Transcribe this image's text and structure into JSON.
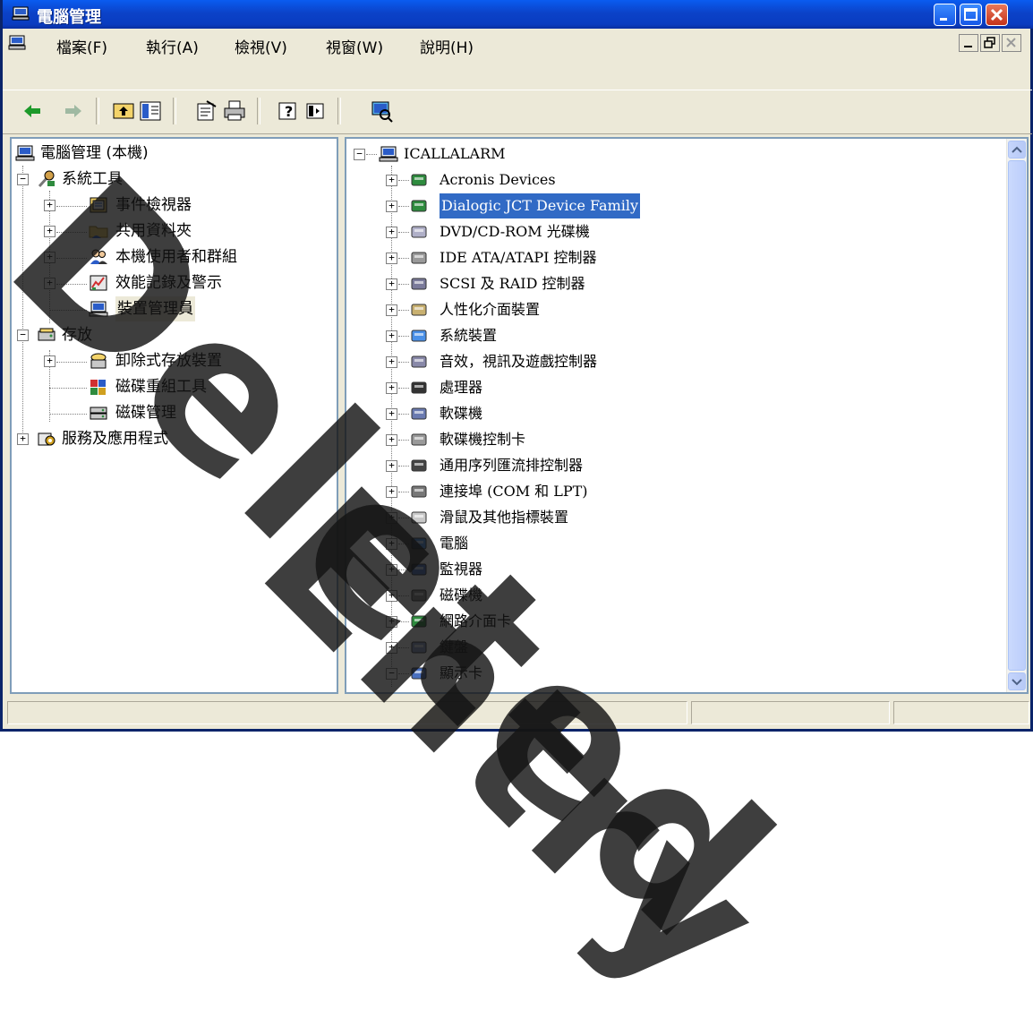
{
  "window": {
    "title": "電腦管理"
  },
  "menu": [
    "檔案(F)",
    "執行(A)",
    "檢視(V)",
    "視窗(W)",
    "說明(H)"
  ],
  "tree": {
    "root": "電腦管理 (本機)",
    "system_tools": "系統工具",
    "event_viewer": "事件檢視器",
    "shared_folders": "共用資料夾",
    "local_users": "本機使用者和群組",
    "perf_logs": "效能記錄及警示",
    "device_manager": "裝置管理員",
    "storage": "存放",
    "removable_storage": "卸除式存放裝置",
    "defrag": "磁碟重組工具",
    "disk_mgmt": "磁碟管理",
    "services": "服務及應用程式"
  },
  "devices": {
    "root": "ICALLALARM",
    "items": [
      "Acronis Devices",
      "Dialogic JCT Device Family",
      "DVD/CD-ROM 光碟機",
      "IDE ATA/ATAPI 控制器",
      "SCSI 及 RAID 控制器",
      "人性化介面裝置",
      "系統裝置",
      "音效，視訊及遊戲控制器",
      "處理器",
      "軟碟機",
      "軟碟機控制卡",
      "通用序列匯流排控制器",
      "連接埠 (COM 和 LPT)",
      "滑鼠及其他指標裝置",
      "電腦",
      "監視器",
      "磁碟機",
      "網路介面卡",
      "鍵盤",
      "顯示卡"
    ],
    "selected_index": 1
  },
  "watermark": {
    "line1": "Deleted",
    "line2": "Entry"
  },
  "colors": {
    "selection": "#316ac5",
    "titlebar": "#0a5cf0",
    "face": "#ece9d8"
  }
}
